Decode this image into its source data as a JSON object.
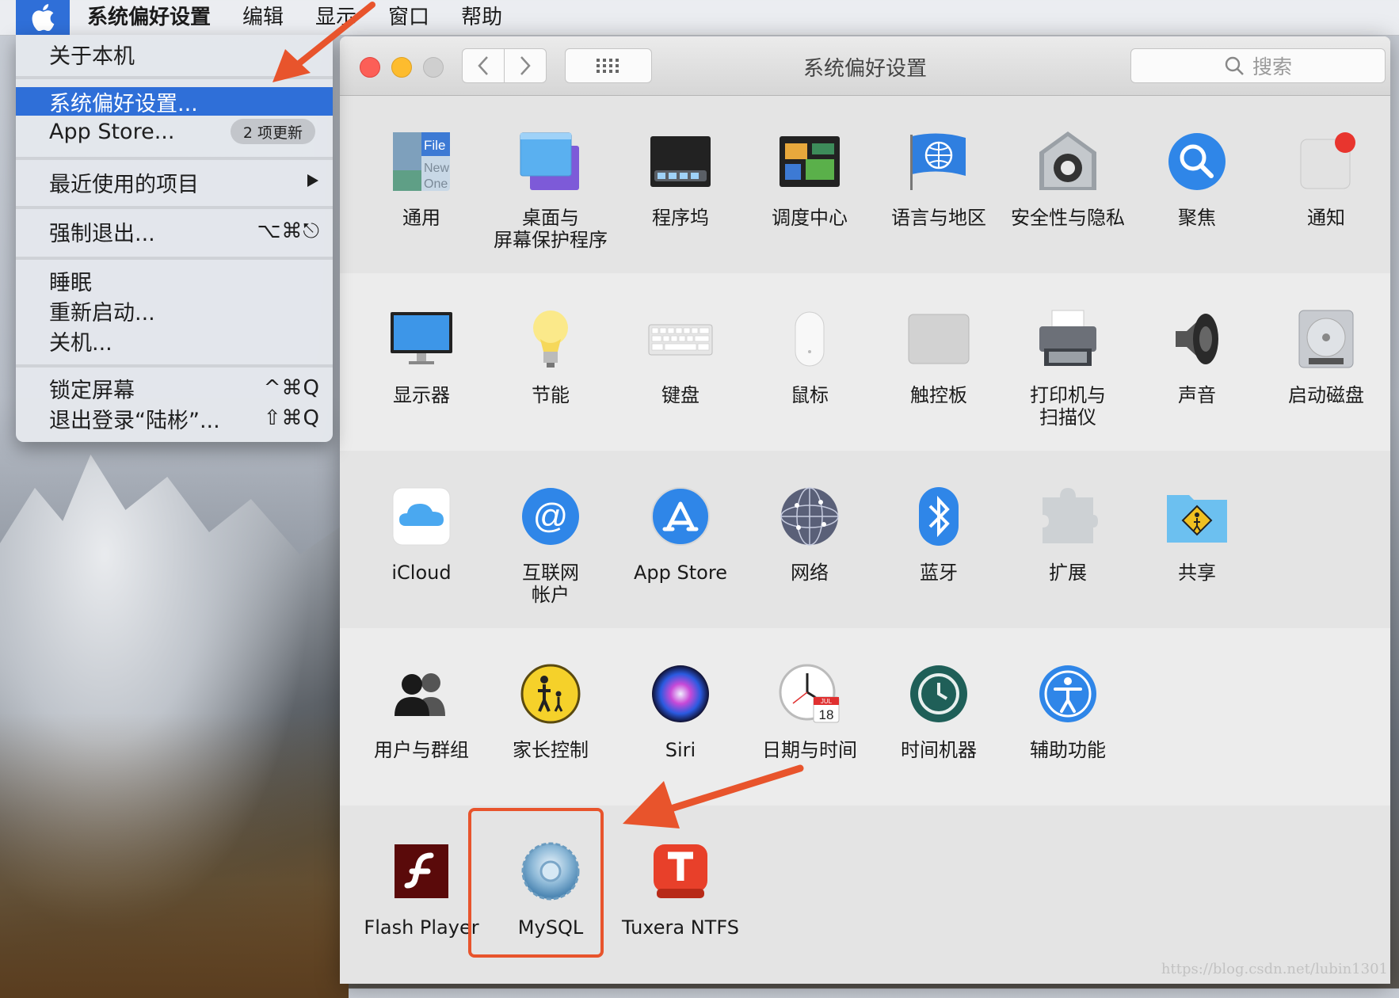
{
  "menubar": {
    "app_name": "系统偏好设置",
    "items": [
      "编辑",
      "显示",
      "窗口",
      "帮助"
    ]
  },
  "apple_menu": {
    "about": "关于本机",
    "system_prefs": "系统偏好设置...",
    "app_store": "App Store...",
    "app_store_badge": "2 项更新",
    "recent_items": "最近使用的项目",
    "force_quit": "强制退出...",
    "force_quit_shortcut": "⌥⌘⎋",
    "sleep": "睡眠",
    "restart": "重新启动...",
    "shutdown": "关机...",
    "lock_screen": "锁定屏幕",
    "lock_screen_shortcut": "^⌘Q",
    "logout": "退出登录“陆彬”...",
    "logout_shortcut": "⇧⌘Q"
  },
  "window": {
    "title": "系统偏好设置",
    "search_placeholder": "搜索"
  },
  "panes": {
    "row1": [
      {
        "name": "通用",
        "icon": "general-icon"
      },
      {
        "name": "桌面与\n屏幕保护程序",
        "icon": "desktop-icon"
      },
      {
        "name": "程序坞",
        "icon": "dock-icon"
      },
      {
        "name": "调度中心",
        "icon": "mission-control-icon"
      },
      {
        "name": "语言与地区",
        "icon": "language-icon"
      },
      {
        "name": "安全性与隐私",
        "icon": "security-icon"
      },
      {
        "name": "聚焦",
        "icon": "spotlight-icon"
      },
      {
        "name": "通知",
        "icon": "notifications-icon"
      }
    ],
    "row2": [
      {
        "name": "显示器",
        "icon": "display-icon"
      },
      {
        "name": "节能",
        "icon": "energy-icon"
      },
      {
        "name": "键盘",
        "icon": "keyboard-icon"
      },
      {
        "name": "鼠标",
        "icon": "mouse-icon"
      },
      {
        "name": "触控板",
        "icon": "trackpad-icon"
      },
      {
        "name": "打印机与\n扫描仪",
        "icon": "printer-icon"
      },
      {
        "name": "声音",
        "icon": "sound-icon"
      },
      {
        "name": "启动磁盘",
        "icon": "startup-disk-icon"
      }
    ],
    "row3": [
      {
        "name": "iCloud",
        "icon": "icloud-icon"
      },
      {
        "name": "互联网\n帐户",
        "icon": "internet-accounts-icon"
      },
      {
        "name": "App Store",
        "icon": "app-store-icon"
      },
      {
        "name": "网络",
        "icon": "network-icon"
      },
      {
        "name": "蓝牙",
        "icon": "bluetooth-icon"
      },
      {
        "name": "扩展",
        "icon": "extensions-icon"
      },
      {
        "name": "共享",
        "icon": "sharing-icon"
      }
    ],
    "row4": [
      {
        "name": "用户与群组",
        "icon": "users-icon"
      },
      {
        "name": "家长控制",
        "icon": "parental-icon"
      },
      {
        "name": "Siri",
        "icon": "siri-icon"
      },
      {
        "name": "日期与时间",
        "icon": "date-time-icon"
      },
      {
        "name": "时间机器",
        "icon": "time-machine-icon"
      },
      {
        "name": "辅助功能",
        "icon": "accessibility-icon"
      }
    ],
    "row5": [
      {
        "name": "Flash Player",
        "icon": "flash-icon"
      },
      {
        "name": "MySQL",
        "icon": "mysql-icon"
      },
      {
        "name": "Tuxera NTFS",
        "icon": "tuxera-icon"
      }
    ]
  },
  "general_icon_text": [
    "File",
    "New",
    "One"
  ],
  "date_icon_text": {
    "month": "JUL",
    "day": "18"
  },
  "watermark": "https://blog.csdn.net/lubin1301",
  "colors": {
    "accent": "#2f6fd8",
    "annotation": "#e8542c"
  }
}
